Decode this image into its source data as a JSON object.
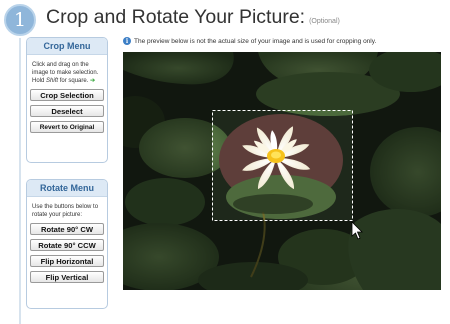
{
  "step": {
    "number": "1"
  },
  "page": {
    "title": "Crop and Rotate Your Picture:",
    "optional": "(Optional)"
  },
  "info": {
    "text": "The preview below is not the actual size of your image and is used for cropping only."
  },
  "crop_menu": {
    "title": "Crop Menu",
    "instructions": "Click and drag on the image to make selection. Hold",
    "shift_word": "Shift",
    "instructions_end": "for square.",
    "buttons": {
      "crop": "Crop Selection",
      "deselect": "Deselect",
      "revert": "Revert to Original"
    }
  },
  "rotate_menu": {
    "title": "Rotate Menu",
    "instructions": "Use the buttons below to rotate your picture:",
    "buttons": {
      "cw": "Rotate 90° CW",
      "ccw": "Rotate 90° CCW",
      "flip_h": "Flip Horizontal",
      "flip_v": "Flip Vertical"
    }
  },
  "colors": {
    "accent": "#336699",
    "panel_header": "#dde9f5",
    "step_circle": "#8fb6da"
  },
  "icons": {
    "step": "step-number-circle",
    "info": "info-icon",
    "arrow": "green-arrow-icon",
    "cursor": "mouse-cursor-icon"
  }
}
